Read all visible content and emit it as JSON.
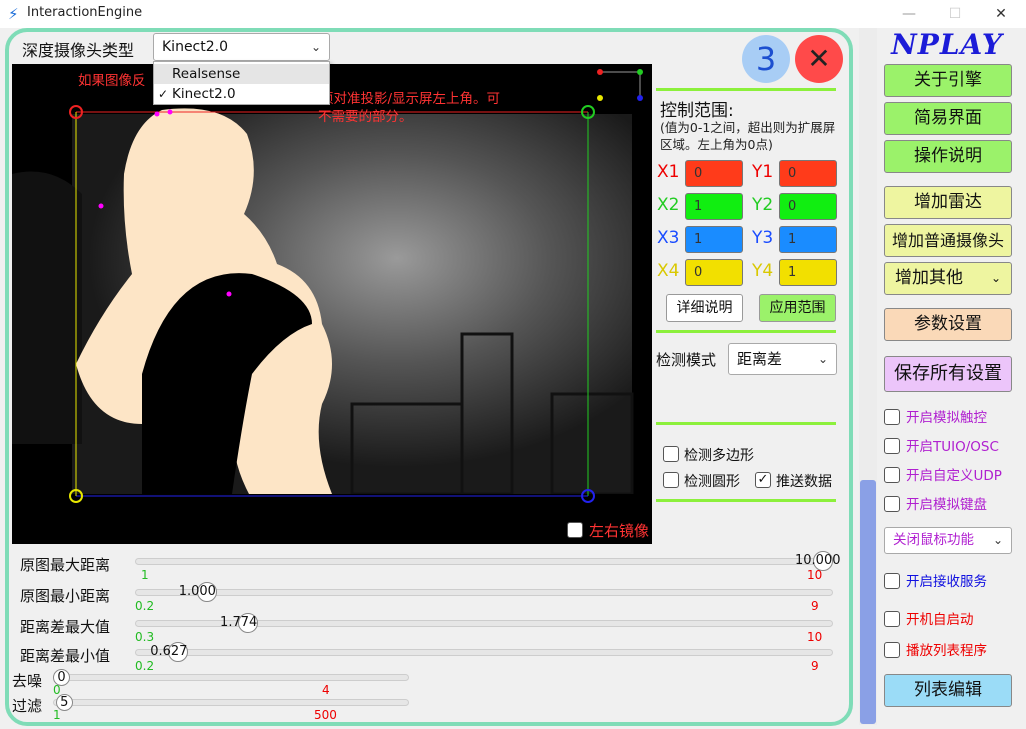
{
  "window": {
    "title": "InteractionEngine",
    "min": "—",
    "max": "☐",
    "close": "✕"
  },
  "camera": {
    "label": "深度摄像头类型",
    "selected": "Kinect2.0",
    "options": [
      "Realsense",
      "Kinect2.0"
    ]
  },
  "badge_number": "3",
  "close_btn": "✕",
  "warning": [
    "如果图像反",
    "圈必须对准投影/显示屏左上角。可",
    "不需要的部分。"
  ],
  "mirror_label": "左右镜像",
  "control": {
    "title": "控制范围:",
    "desc": "(值为0-1之间，超出则为扩展屏区域。左上角为0点)",
    "coords": [
      {
        "xl": "X1",
        "xv": "0",
        "yl": "Y1",
        "yv": "0",
        "color": "#ff3b1a",
        "lc": "#ee0000"
      },
      {
        "xl": "X2",
        "xv": "1",
        "yl": "Y2",
        "yv": "0",
        "color": "#11ee11",
        "lc": "#22cc22"
      },
      {
        "xl": "X3",
        "xv": "1",
        "yl": "Y3",
        "yv": "1",
        "color": "#1a8cff",
        "lc": "#1a4cff"
      },
      {
        "xl": "X4",
        "xv": "0",
        "yl": "Y4",
        "yv": "1",
        "color": "#f2e000",
        "lc": "#d9c800"
      }
    ],
    "detail_btn": "详细说明",
    "apply_btn": "应用范围"
  },
  "detect": {
    "mode_label": "检测模式",
    "mode_value": "距离差",
    "polygon": "检测多边形",
    "circle": "检测圆形",
    "push": "推送数据"
  },
  "sliders": [
    {
      "label": "原图最大距离",
      "value": "10.000",
      "min": "1",
      "max": "10",
      "pos": 1.0
    },
    {
      "label": "原图最小距离",
      "value": "1.000",
      "min": "0.2",
      "max": "9",
      "pos": 0.091
    },
    {
      "label": "距离差最大值",
      "value": "1.774",
      "min": "0.3",
      "max": "10",
      "pos": 0.152
    },
    {
      "label": "距离差最小值",
      "value": "0.627",
      "min": "0.2",
      "max": "9",
      "pos": 0.049
    }
  ],
  "small_sliders": [
    {
      "label": "去噪",
      "value": "0",
      "min": "0",
      "max": "4",
      "pos": 0.0
    },
    {
      "label": "过滤",
      "value": "5",
      "min": "1",
      "max": "500",
      "pos": 0.008
    }
  ],
  "logo": "NPLAY",
  "right": {
    "about": "关于引擎",
    "simple": "简易界面",
    "manual": "操作说明",
    "add_radar": "增加雷达",
    "add_cam": "增加普通摄像头",
    "add_other": "增加其他",
    "params": "参数设置",
    "save_all": "保存所有设置",
    "checks": [
      "开启模拟触控",
      "开启TUIO/OSC",
      "开启自定义UDP",
      "开启模拟键盘"
    ],
    "mouse_select": "关闭鼠标功能",
    "recv_service": "开启接收服务",
    "autostart": "开机自启动",
    "playlist": "播放列表程序",
    "list_edit": "列表编辑"
  }
}
